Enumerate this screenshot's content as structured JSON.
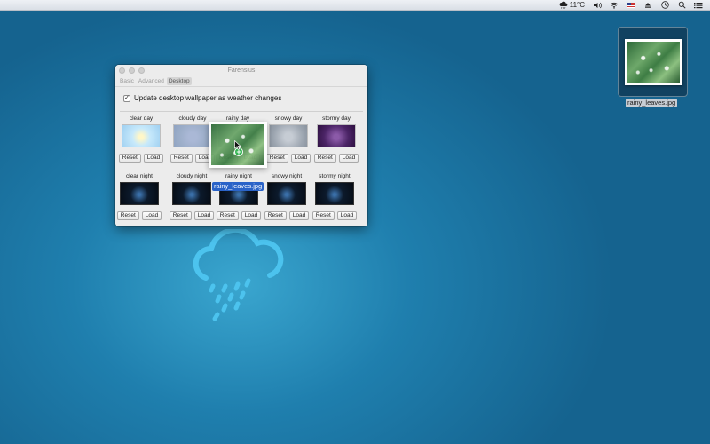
{
  "menubar": {
    "temperature": "11°C",
    "icons": [
      "weather-cloud-icon",
      "volume-icon",
      "wifi-icon",
      "us-flag-icon",
      "eject-icon",
      "clock-icon",
      "search-icon",
      "list-icon"
    ]
  },
  "window": {
    "title": "Farensius",
    "tabs": [
      {
        "label": "Basic",
        "active": false
      },
      {
        "label": "Advanced",
        "active": false
      },
      {
        "label": "Desktop",
        "active": true
      }
    ],
    "checkbox": {
      "label": "Update desktop wallpaper as weather changes",
      "checked": true,
      "mark": "✓"
    },
    "day_slots": [
      {
        "label": "clear day"
      },
      {
        "label": "cloudy day"
      },
      {
        "label": "rainy day"
      },
      {
        "label": "snowy day"
      },
      {
        "label": "stormy day"
      }
    ],
    "night_slots": [
      {
        "label": "clear night"
      },
      {
        "label": "cloudy night"
      },
      {
        "label": "rainy night"
      },
      {
        "label": "snowy night"
      },
      {
        "label": "stormy night"
      }
    ],
    "reset_label": "Reset",
    "load_label": "Load"
  },
  "drag": {
    "filename": "rainy_leaves.jpg",
    "badge": "+"
  },
  "desktop": {
    "file_label": "rainy_leaves.jpg"
  },
  "colors": {
    "desktop_bg": "#1f7fae",
    "weather_icon": "#4cc3ee",
    "selection": "#2a63c8",
    "add_badge": "#2bb34a"
  }
}
